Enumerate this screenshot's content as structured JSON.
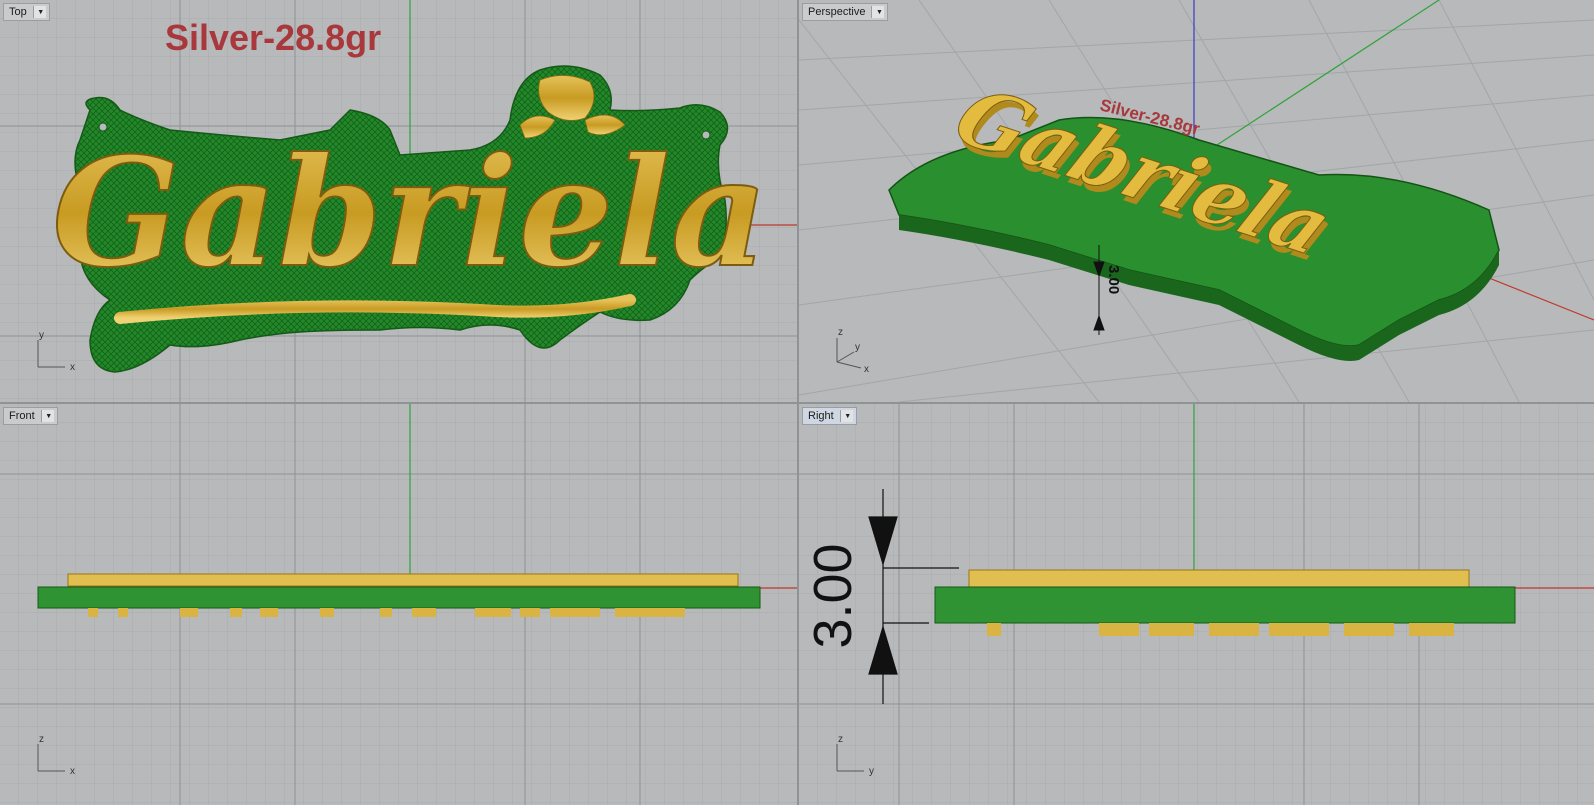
{
  "viewports": {
    "top": {
      "label": "Top",
      "axis_x": "x",
      "axis_y": "y"
    },
    "perspective": {
      "label": "Perspective",
      "axis_x": "x",
      "axis_y": "y",
      "axis_z": "z"
    },
    "front": {
      "label": "Front",
      "axis_x": "x",
      "axis_z": "z"
    },
    "right": {
      "label": "Right",
      "axis_y": "y",
      "axis_z": "z"
    }
  },
  "model": {
    "name_text": "Gabriela",
    "weight_label": "Silver-28.8gr",
    "thickness_dimension": "3.00"
  },
  "colors": {
    "viewport_bg": "#b7b9bb",
    "grid_minor": "#a9acae",
    "grid_major": "#8f9396",
    "axis_x": "#c0392b",
    "axis_y": "#2fa33a",
    "axis_z": "#3b3bbf",
    "base_green": "#1f7a22",
    "letter_gold": "#c9a227",
    "label_red": "#a8383b"
  }
}
